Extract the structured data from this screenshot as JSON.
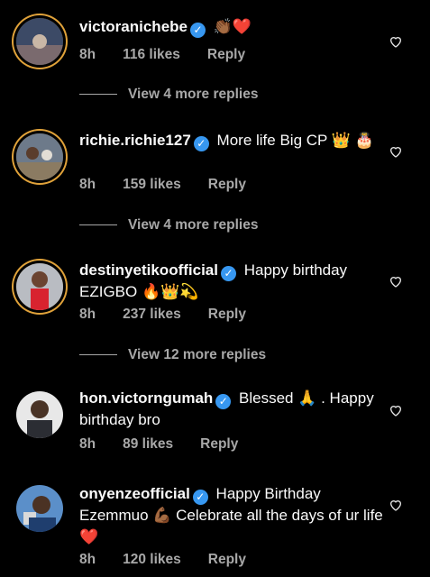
{
  "comments": [
    {
      "user": "victoranichebe",
      "text": "👏🏾❤️",
      "time": "8h",
      "likes": "116 likes",
      "reply": "Reply"
    },
    {
      "user": "richie.richie127",
      "text": "More life Big CP 👑 🎂",
      "time": "8h",
      "likes": "159 likes",
      "reply": "Reply"
    },
    {
      "user": "destinyetikoofficial",
      "text": "Happy birthday EZIGBO 🔥👑💫",
      "time": "8h",
      "likes": "237 likes",
      "reply": "Reply"
    },
    {
      "user": "hon.victorngumah",
      "text": "Blessed 🙏 . Happy birthday bro",
      "time": "8h",
      "likes": "89 likes",
      "reply": "Reply"
    },
    {
      "user": "onyenzeofficial",
      "text": "Happy Birthday Ezemmuo 💪🏾 Celebrate all the days of ur life❤️",
      "time": "8h",
      "likes": "120 likes",
      "reply": "Reply"
    }
  ],
  "more_replies": [
    "View 4 more replies",
    "View 4 more replies",
    "View 12 more replies"
  ]
}
